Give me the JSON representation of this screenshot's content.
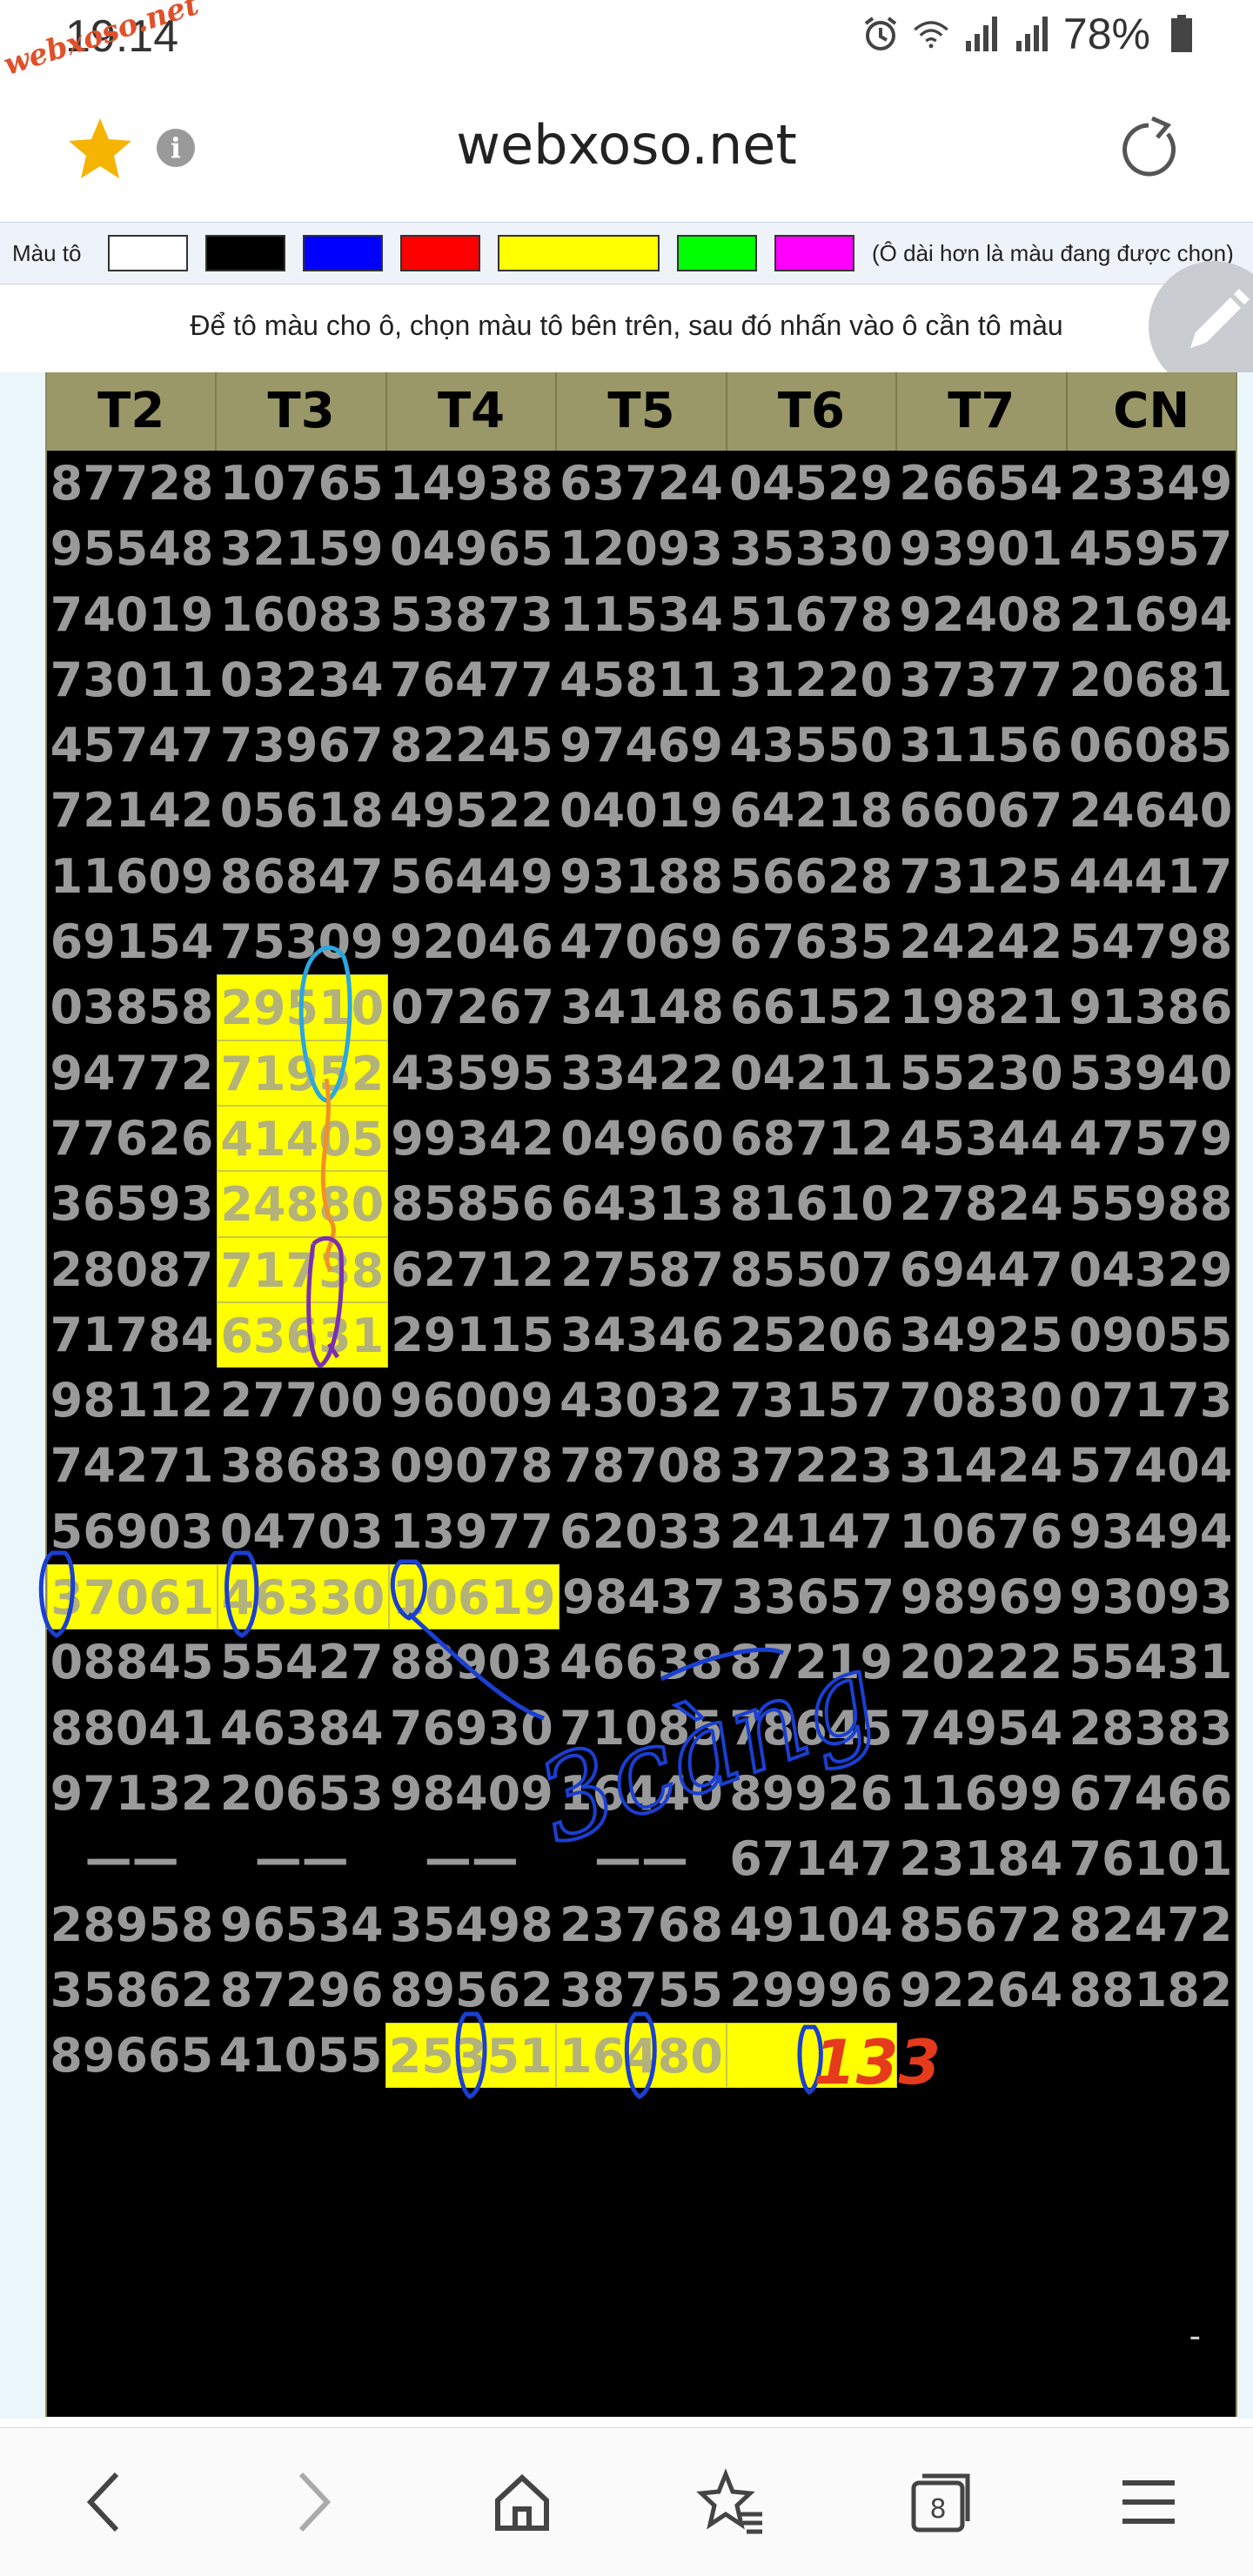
{
  "status_bar": {
    "time": "19:14",
    "watermark": "webxoso.net",
    "battery": "78%",
    "icons": [
      "alarm-icon",
      "wifi-icon",
      "signal-icon",
      "signal-icon-2",
      "battery-icon"
    ]
  },
  "address_bar": {
    "url": "webxoso.net",
    "info_glyph": "i",
    "icons": [
      "star-icon",
      "info-icon",
      "reload-icon"
    ]
  },
  "palette": {
    "label": "Màu tô",
    "swatches": [
      "#ffffff",
      "#000000",
      "#0000ff",
      "#ff0000",
      "#ffff00",
      "#00ff00",
      "#ff00ff"
    ],
    "note": "(Ô dài hơn là màu đang được chọn)"
  },
  "instruction": "Để tô màu cho ô, chọn màu tô bên trên, sau đó nhấn vào ô cần tô màu",
  "colors": {
    "header_bg": "#9a9868",
    "grid_bg": "#000000",
    "number": "#9a9a9a",
    "highlight": "#ffff00",
    "ink_blue": "#1a3fd1",
    "ink_red": "#e53a1c",
    "ink_purple": "#7b2fb0",
    "ink_orange": "#f0902a",
    "ink_cyan": "#2aa6e0"
  },
  "table": {
    "headers": [
      "T2",
      "T3",
      "T4",
      "T5",
      "T6",
      "T7",
      "CN"
    ],
    "rows": [
      [
        "87728",
        "10765",
        "14938",
        "63724",
        "04529",
        "26654",
        "23349"
      ],
      [
        "95548",
        "32159",
        "04965",
        "12093",
        "35330",
        "93901",
        "45957"
      ],
      [
        "74019",
        "16083",
        "53873",
        "11534",
        "51678",
        "92408",
        "21694"
      ],
      [
        "73011",
        "03234",
        "76477",
        "45811",
        "31220",
        "37377",
        "20681"
      ],
      [
        "45747",
        "73967",
        "82245",
        "97469",
        "43550",
        "31156",
        "06085"
      ],
      [
        "72142",
        "05618",
        "49522",
        "04019",
        "64218",
        "66067",
        "24640"
      ],
      [
        "11609",
        "86847",
        "56449",
        "93188",
        "56628",
        "73125",
        "44417"
      ],
      [
        "69154",
        "75309",
        "92046",
        "47069",
        "67635",
        "24242",
        "54798"
      ],
      [
        "03858",
        "29510",
        "07267",
        "34148",
        "66152",
        "19821",
        "91386"
      ],
      [
        "94772",
        "71952",
        "43595",
        "33422",
        "04211",
        "55230",
        "53940"
      ],
      [
        "77626",
        "41405",
        "99342",
        "04960",
        "68712",
        "45344",
        "47579"
      ],
      [
        "36593",
        "24880",
        "85856",
        "64313",
        "81610",
        "27824",
        "55988"
      ],
      [
        "28087",
        "71738",
        "62712",
        "27587",
        "85507",
        "69447",
        "04329"
      ],
      [
        "71784",
        "63631",
        "29115",
        "34346",
        "25206",
        "34925",
        "09055"
      ],
      [
        "98112",
        "27700",
        "96009",
        "43032",
        "73157",
        "70830",
        "07173"
      ],
      [
        "74271",
        "38683",
        "09078",
        "78708",
        "37223",
        "31424",
        "57404"
      ],
      [
        "56903",
        "04703",
        "13977",
        "62033",
        "24147",
        "10676",
        "93494"
      ],
      [
        "37061",
        "46330",
        "10619",
        "98437",
        "33657",
        "98969",
        "93093"
      ],
      [
        "08845",
        "55427",
        "88903",
        "46638",
        "87219",
        "20222",
        "55431"
      ],
      [
        "88041",
        "46384",
        "76930",
        "71085",
        "78645",
        "74954",
        "28383"
      ],
      [
        "97132",
        "20653",
        "98409",
        "16440",
        "89926",
        "11699",
        "67466"
      ],
      [
        "——",
        "——",
        "——",
        "——",
        "67147",
        "23184",
        "76101"
      ],
      [
        "28958",
        "96534",
        "35498",
        "23768",
        "49104",
        "85672",
        "82472"
      ],
      [
        "35862",
        "87296",
        "89562",
        "38755",
        "29996",
        "92264",
        "88182"
      ],
      [
        "89665",
        "41055",
        "25351",
        "16480",
        "",
        "",
        ""
      ]
    ],
    "highlighted": [
      [
        8,
        1
      ],
      [
        9,
        1
      ],
      [
        10,
        1
      ],
      [
        11,
        1
      ],
      [
        12,
        1
      ],
      [
        13,
        1
      ],
      [
        17,
        0
      ],
      [
        17,
        1
      ],
      [
        17,
        2
      ],
      [
        24,
        2
      ],
      [
        24,
        3
      ],
      [
        24,
        4
      ]
    ],
    "corner_mark": "-"
  },
  "handwriting": {
    "main_word": "3càng",
    "red_number": "133"
  },
  "bottom_nav": {
    "tab_count": "8",
    "icons": [
      "back-icon",
      "forward-icon",
      "home-icon",
      "bookmarks-icon",
      "tabs-icon",
      "menu-icon"
    ]
  }
}
